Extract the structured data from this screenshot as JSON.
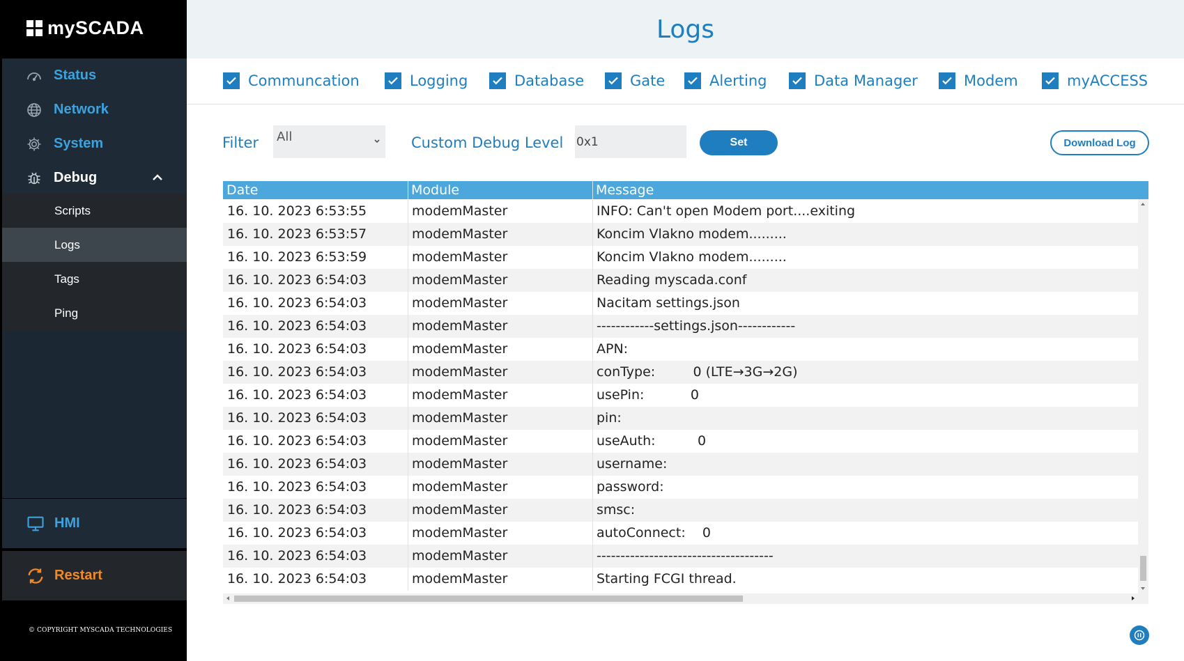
{
  "brand": {
    "name": "mySCADA"
  },
  "sidebar": {
    "items": [
      {
        "label": "Status",
        "icon": "speedometer-icon"
      },
      {
        "label": "Network",
        "icon": "globe-icon"
      },
      {
        "label": "System",
        "icon": "gear-icon"
      },
      {
        "label": "Debug",
        "icon": "bug-icon"
      }
    ],
    "debug_sub": [
      {
        "label": "Scripts"
      },
      {
        "label": "Logs",
        "active": true
      },
      {
        "label": "Tags"
      },
      {
        "label": "Ping"
      }
    ],
    "hmi_label": "HMI",
    "restart_label": "Restart",
    "copyright": "© COPYRIGHT MYSCADA TECHNOLOGIES"
  },
  "header": {
    "title": "Logs"
  },
  "modules": [
    {
      "label": "Communcation",
      "checked": true
    },
    {
      "label": "Logging",
      "checked": true
    },
    {
      "label": "Database",
      "checked": true
    },
    {
      "label": "Gate",
      "checked": true
    },
    {
      "label": "Alerting",
      "checked": true
    },
    {
      "label": "Data Manager",
      "checked": true
    },
    {
      "label": "Modem",
      "checked": true
    },
    {
      "label": "myACCESS",
      "checked": true
    }
  ],
  "controls": {
    "filter_label": "Filter",
    "filter_value": "All",
    "debug_label": "Custom Debug Level",
    "debug_value": "0x1",
    "set_label": "Set",
    "download_label": "Download Log"
  },
  "table": {
    "columns": [
      "Date",
      "Module",
      "Message"
    ],
    "rows": [
      [
        "16. 10. 2023 6:53:55",
        "modemMaster",
        "INFO: Can't open Modem port....exiting"
      ],
      [
        "16. 10. 2023 6:53:57",
        "modemMaster",
        "Koncim Vlakno modem........."
      ],
      [
        "16. 10. 2023 6:53:59",
        "modemMaster",
        "Koncim Vlakno modem........."
      ],
      [
        "16. 10. 2023 6:54:03",
        "modemMaster",
        "Reading myscada.conf"
      ],
      [
        "16. 10. 2023 6:54:03",
        "modemMaster",
        "Nacitam settings.json"
      ],
      [
        "16. 10. 2023 6:54:03",
        "modemMaster",
        "------------settings.json------------"
      ],
      [
        "16. 10. 2023 6:54:03",
        "modemMaster",
        "APN:"
      ],
      [
        "16. 10. 2023 6:54:03",
        "modemMaster",
        "conType:         0 (LTE→3G→2G)"
      ],
      [
        "16. 10. 2023 6:54:03",
        "modemMaster",
        "usePin:           0"
      ],
      [
        "16. 10. 2023 6:54:03",
        "modemMaster",
        "pin:"
      ],
      [
        "16. 10. 2023 6:54:03",
        "modemMaster",
        "useAuth:          0"
      ],
      [
        "16. 10. 2023 6:54:03",
        "modemMaster",
        "username:"
      ],
      [
        "16. 10. 2023 6:54:03",
        "modemMaster",
        "password:"
      ],
      [
        "16. 10. 2023 6:54:03",
        "modemMaster",
        "smsc:"
      ],
      [
        "16. 10. 2023 6:54:03",
        "modemMaster",
        "autoConnect:    0"
      ],
      [
        "16. 10. 2023 6:54:03",
        "modemMaster",
        "-------------------------------------"
      ],
      [
        "16. 10. 2023 6:54:03",
        "modemMaster",
        "Starting FCGI thread."
      ]
    ]
  },
  "colors": {
    "accent": "#1f7ec0",
    "header_row": "#4ba7dc",
    "sidebar_nav": "#3da2dd",
    "restart": "#f08a24"
  }
}
